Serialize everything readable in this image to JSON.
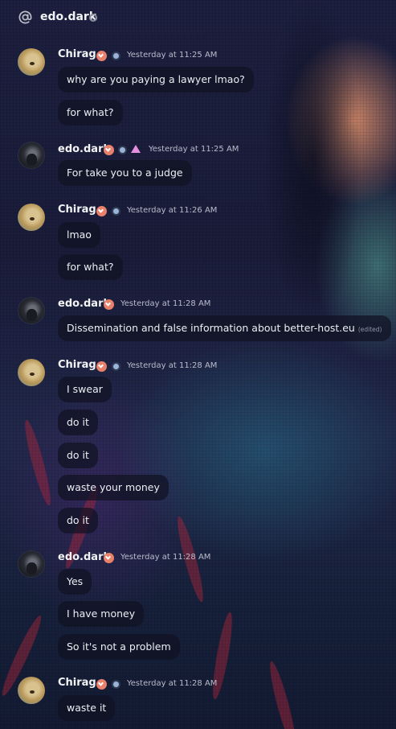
{
  "header": {
    "title": "edo.dark"
  },
  "messages": [
    {
      "author": "Chirag.",
      "avatar": "doge-avatar",
      "time": "Yesterday at 11:25 AM",
      "lines": [
        "why are you paying a lawyer lmao?",
        "for what?"
      ]
    },
    {
      "author": "edo.dark",
      "avatar": "person-avatar",
      "time": "Yesterday at 11:25 AM",
      "lines": [
        "For take you to a judge"
      ]
    },
    {
      "author": "Chirag.",
      "avatar": "doge-avatar",
      "time": "Yesterday at 11:26 AM",
      "lines": [
        "lmao",
        "for what?"
      ]
    },
    {
      "author": "edo.dark",
      "avatar": "person-avatar",
      "time": "Yesterday at 11:28 AM",
      "lines": [
        "Dissemination and false information about better-host.eu"
      ],
      "edited": "(edited)"
    },
    {
      "author": "Chirag.",
      "avatar": "doge-avatar",
      "time": "Yesterday at 11:28 AM",
      "lines": [
        "I swear",
        "do it",
        "do it",
        "waste your money",
        "do it"
      ]
    },
    {
      "author": "edo.dark",
      "avatar": "person-avatar",
      "time": "Yesterday at 11:28 AM",
      "lines": [
        "Yes",
        "I have money",
        "So it's not a problem"
      ]
    },
    {
      "author": "Chirag.",
      "avatar": "doge-avatar",
      "time": "Yesterday at 11:28 AM",
      "lines": [
        "waste it"
      ]
    }
  ],
  "theme": {
    "heart_badge": "#e8806a",
    "triangle_badge": "#e58fe0",
    "bubble": "#101222"
  }
}
